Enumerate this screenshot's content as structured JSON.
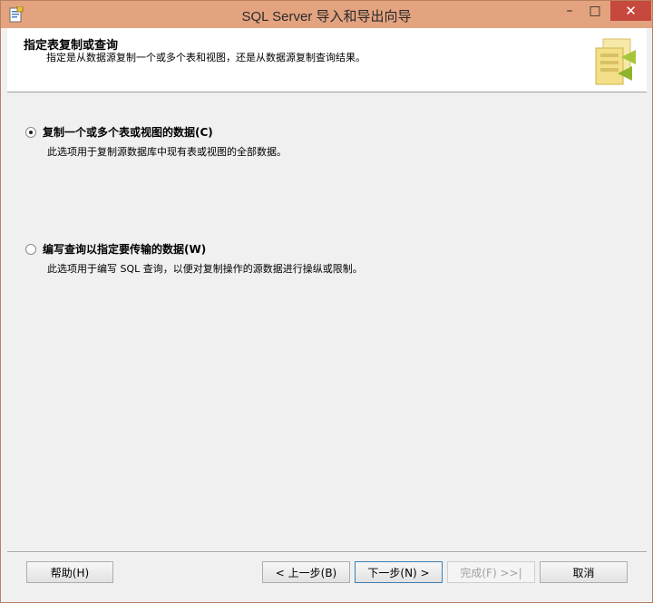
{
  "window": {
    "title": "SQL Server 导入和导出向导",
    "controls": {
      "minimize": "–",
      "maximize": "□",
      "close": "✕"
    },
    "colors": {
      "titlebar": "#e3a37f",
      "close": "#c7483c"
    }
  },
  "header": {
    "title": "指定表复制或查询",
    "subtitle": "指定是从数据源复制一个或多个表和视图，还是从数据源复制查询结果。",
    "image_icon": "wizard-table-copy-icon"
  },
  "options": [
    {
      "label": "复制一个或多个表或视图的数据(C)",
      "description": "此选项用于复制源数据库中现有表或视图的全部数据。",
      "checked": true
    },
    {
      "label": "编写查询以指定要传输的数据(W)",
      "description": "此选项用于编写 SQL 查询，以便对复制操作的源数据进行操纵或限制。",
      "checked": false
    }
  ],
  "buttons": {
    "help": "帮助(H)",
    "back": "< 上一步(B)",
    "next": "下一步(N) >",
    "finish": "完成(F) >>|",
    "cancel": "取消"
  }
}
